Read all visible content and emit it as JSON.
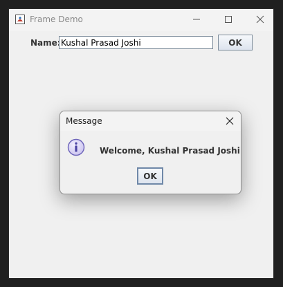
{
  "window": {
    "title": "Frame Demo",
    "icon": "java-app-icon",
    "controls": [
      "minimize-icon",
      "maximize-icon",
      "close-icon"
    ]
  },
  "form": {
    "name_label": "Name:",
    "name_value": "Kushal Prasad Joshi",
    "ok_label": "OK"
  },
  "dialog": {
    "title": "Message",
    "icon": "info-icon",
    "message": "Welcome, Kushal Prasad Joshi",
    "ok_label": "OK"
  },
  "colors": {
    "window_bg": "#f0f0f0",
    "desktop_bg": "#202020",
    "button_border": "#7a8a99",
    "info_icon_fill": "#d7d2f2",
    "info_icon_stroke": "#6a61b8"
  }
}
